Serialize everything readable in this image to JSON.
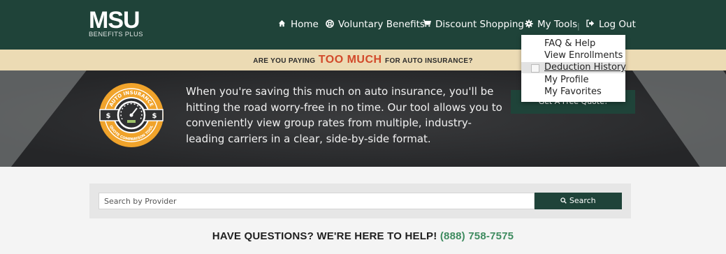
{
  "logo": {
    "main": "MSU",
    "sub": "BENEFITS PLUS"
  },
  "nav": {
    "home": "Home",
    "voluntary_benefits": "Voluntary Benefits",
    "discount_shopping": "Discount Shopping",
    "my_tools": "My Tools",
    "separator": "|",
    "log_out": "Log Out",
    "icons": {
      "home": "home-icon",
      "voluntary": "lifebuoy-icon",
      "shopping": "cart-icon",
      "tools": "gear-icon",
      "logout": "logout-icon"
    }
  },
  "dropdown": {
    "items": [
      "FAQ & Help",
      "View Enrollments",
      "Deduction History",
      "My Profile",
      "My Favorites"
    ],
    "highlighted_index": 2
  },
  "promo": {
    "pre": "ARE YOU PAYING",
    "highlight": "TOO MUCH",
    "post": "FOR AUTO INSURANCE?"
  },
  "hero": {
    "badge_top": "AUTO INSURANCE",
    "badge_bottom": "QUOTE COMPARISON TOOL",
    "badge_left_symbol": "$",
    "badge_right_symbol": "$",
    "text": "When you're saving this much on auto insurance, you'll be hitting the road worry-free in no time. Our tool allows you to conveniently view group rates from multiple, industry-leading carriers in a clear, side-by-side format.",
    "cta": "Get A Free Quote!"
  },
  "search": {
    "placeholder": "Search by Provider",
    "value": "",
    "button": "Search"
  },
  "help": {
    "text": "HAVE QUESTIONS? WE'RE HERE TO HELP!",
    "phone": "(888) 758-7575"
  },
  "colors": {
    "brand": "#1f4339",
    "accent": "#d2492a",
    "promo_bg": "#ecdbb4",
    "phone": "#3e8b5f",
    "badge": "#f0a32b"
  }
}
